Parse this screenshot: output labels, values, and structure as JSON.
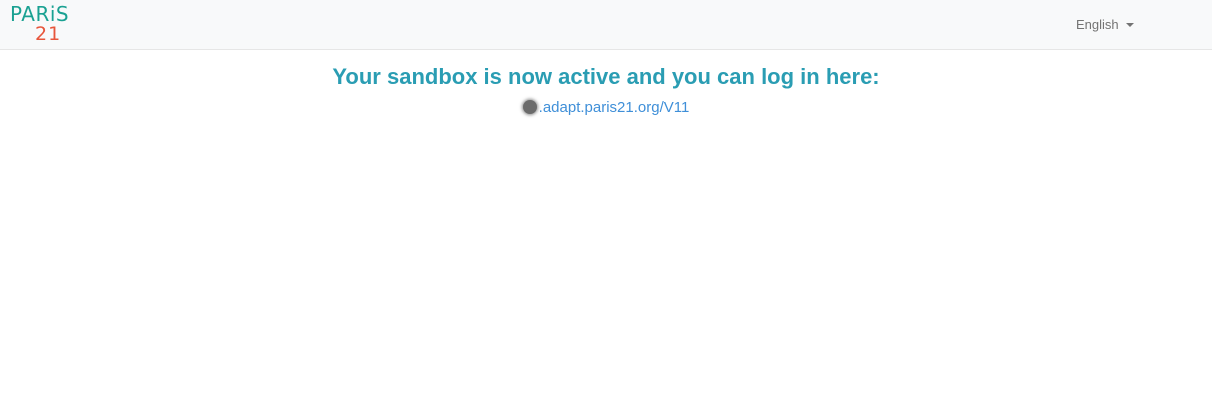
{
  "header": {
    "logo": {
      "line1": "PARiS",
      "line2": "21"
    },
    "language": {
      "selected": "English"
    }
  },
  "main": {
    "title": "Your sandbox is now active and you can log in here:",
    "link_text": ".adapt.paris21.org/V11"
  },
  "colors": {
    "title": "#2a9db3",
    "link": "#3f8fd8",
    "logo_green": "#1aa192",
    "logo_orange": "#e7553b"
  }
}
